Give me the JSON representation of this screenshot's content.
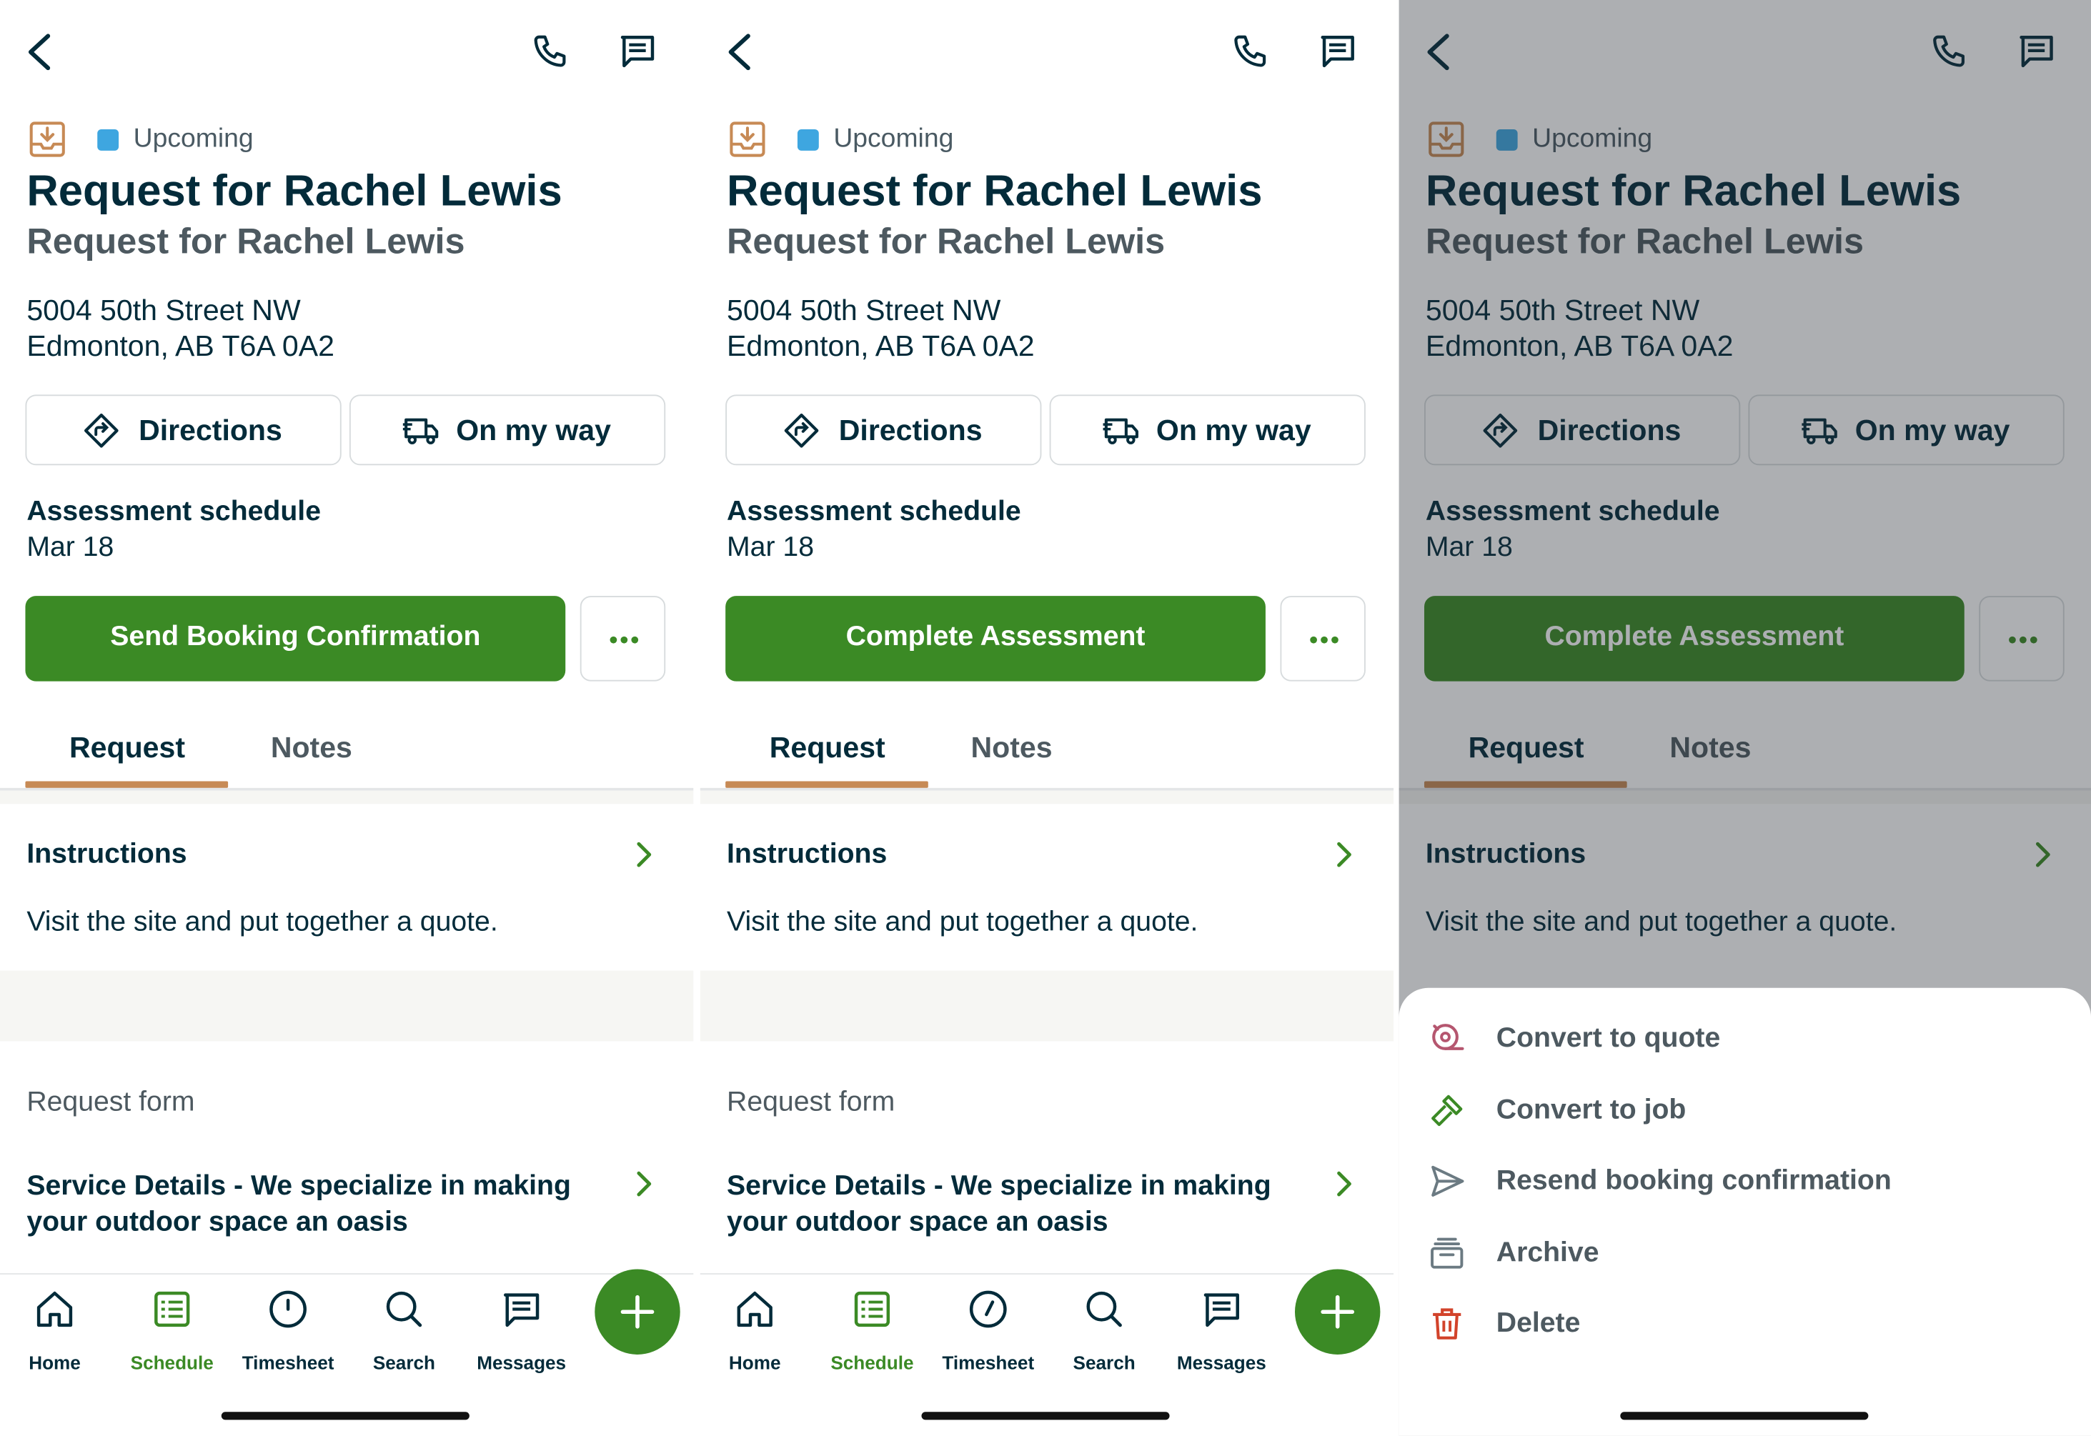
{
  "colors": {
    "brand_green": "#3b8a25",
    "navy_text": "#032b3a",
    "muted_text": "#4d5960",
    "status_upcoming": "#3ea6e0",
    "tab_underline": "#c78a55",
    "delete_red": "#d2432b",
    "quote_pink": "#b5566f"
  },
  "icons": {
    "back": "chevron-left-icon",
    "call": "phone-icon",
    "message": "message-icon",
    "request": "inbox-download-icon",
    "directions": "directions-icon",
    "on_my_way": "truck-icon",
    "more": "ellipsis-icon",
    "chevron": "chevron-right-icon"
  },
  "screens": [
    {
      "status": "Upcoming",
      "title": "Request for Rachel Lewis",
      "subtitle": "Request for Rachel Lewis",
      "address_line1": "5004 50th Street NW",
      "address_line2": "Edmonton, AB T6A 0A2",
      "directions_label": "Directions",
      "on_my_way_label": "On my way",
      "schedule_label": "Assessment schedule",
      "schedule_date": "Mar 18",
      "primary_action": "Send Booking Confirmation",
      "tabs": [
        "Request",
        "Notes"
      ],
      "instructions_title": "Instructions",
      "instructions_text": "Visit the site and put together a quote.",
      "request_form_label": "Request form",
      "service_details": "Service Details - We specialize in making your outdoor space an oasis"
    },
    {
      "status": "Upcoming",
      "title": "Request for Rachel Lewis",
      "subtitle": "Request for Rachel Lewis",
      "address_line1": "5004 50th Street NW",
      "address_line2": "Edmonton, AB T6A 0A2",
      "directions_label": "Directions",
      "on_my_way_label": "On my way",
      "schedule_label": "Assessment schedule",
      "schedule_date": "Mar 18",
      "primary_action": "Complete Assessment",
      "tabs": [
        "Request",
        "Notes"
      ],
      "instructions_title": "Instructions",
      "instructions_text": "Visit the site and put together a quote.",
      "request_form_label": "Request form",
      "service_details": "Service Details - We specialize in making your outdoor space an oasis"
    },
    {
      "status": "Upcoming",
      "title": "Request for Rachel Lewis",
      "subtitle": "Request for Rachel Lewis",
      "address_line1": "5004 50th Street NW",
      "address_line2": "Edmonton, AB T6A 0A2",
      "directions_label": "Directions",
      "on_my_way_label": "On my way",
      "schedule_label": "Assessment schedule",
      "schedule_date": "Mar 18",
      "primary_action": "Complete Assessment",
      "tabs": [
        "Request",
        "Notes"
      ],
      "instructions_title": "Instructions",
      "instructions_text": "Visit the site and put together a quote.",
      "action_sheet": [
        {
          "label": "Convert to quote",
          "icon": "quote-tape-icon"
        },
        {
          "label": "Convert to job",
          "icon": "hammer-icon"
        },
        {
          "label": "Resend booking confirmation",
          "icon": "send-icon"
        },
        {
          "label": "Archive",
          "icon": "archive-icon"
        },
        {
          "label": "Delete",
          "icon": "trash-icon"
        }
      ]
    }
  ],
  "bottom_nav": [
    {
      "label": "Home",
      "icon": "home-icon",
      "active": false
    },
    {
      "label": "Schedule",
      "icon": "schedule-icon",
      "active": true
    },
    {
      "label": "Timesheet",
      "icon": "clock-icon",
      "active": false
    },
    {
      "label": "Search",
      "icon": "search-icon",
      "active": false
    },
    {
      "label": "Messages",
      "icon": "messages-icon",
      "active": false
    }
  ],
  "fab_icon": "plus-icon"
}
